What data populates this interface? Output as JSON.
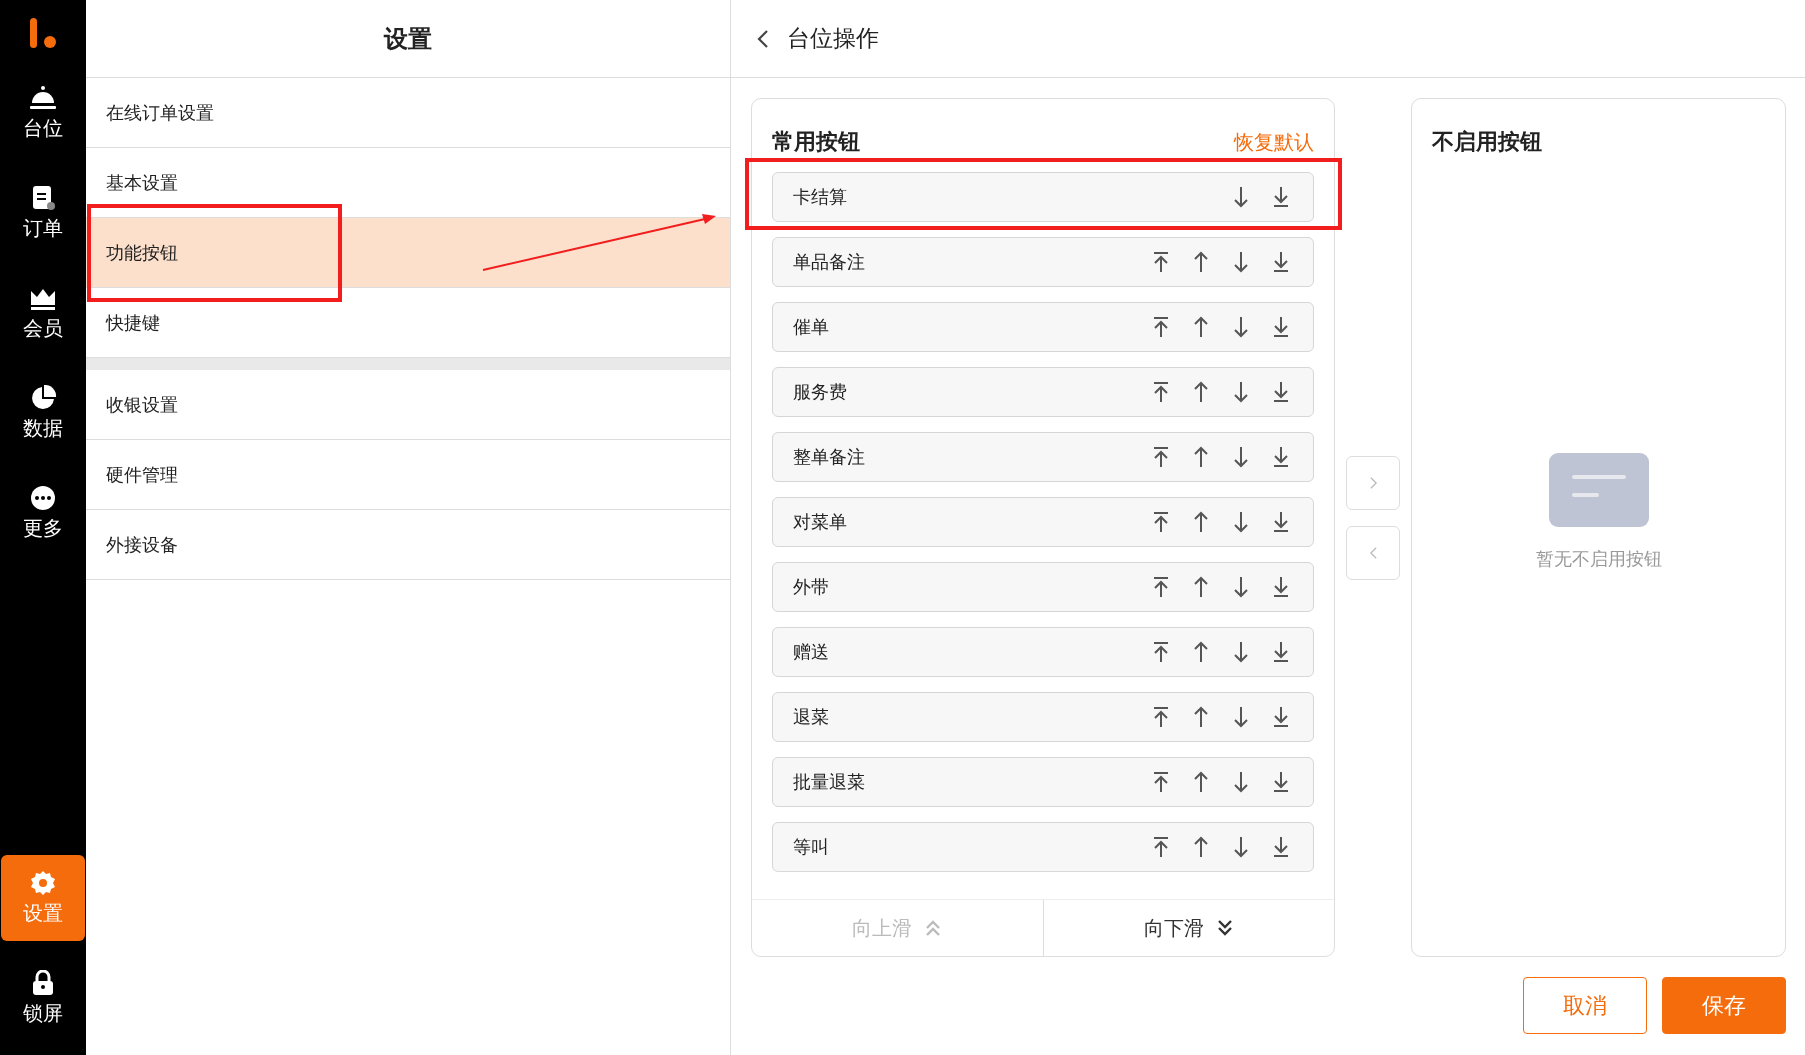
{
  "sidebar": {
    "items": [
      {
        "kind": "table",
        "label": "台位",
        "selected": false
      },
      {
        "kind": "order",
        "label": "订单",
        "selected": false
      },
      {
        "kind": "member",
        "label": "会员",
        "selected": false
      },
      {
        "kind": "data",
        "label": "数据",
        "selected": false
      },
      {
        "kind": "more",
        "label": "更多",
        "selected": false
      }
    ],
    "bottom_items": [
      {
        "kind": "settings",
        "label": "设置",
        "selected": true
      },
      {
        "kind": "lock",
        "label": "锁屏",
        "selected": false
      }
    ]
  },
  "settings": {
    "title": "设置",
    "groups": [
      [
        {
          "label": "在线订单设置",
          "selected": false
        },
        {
          "label": "基本设置",
          "selected": false
        },
        {
          "label": "功能按钮",
          "selected": true
        },
        {
          "label": "快捷键",
          "selected": false
        }
      ],
      [
        {
          "label": "收银设置",
          "selected": false
        },
        {
          "label": "硬件管理",
          "selected": false
        },
        {
          "label": "外接设备",
          "selected": false
        }
      ]
    ]
  },
  "page": {
    "title": "台位操作"
  },
  "common_buttons": {
    "title": "常用按钮",
    "reset": "恢复默认",
    "rows": [
      {
        "label": "卡结算",
        "movable_up": false
      },
      {
        "label": "单品备注",
        "movable_up": true
      },
      {
        "label": "催单",
        "movable_up": true
      },
      {
        "label": "服务费",
        "movable_up": true
      },
      {
        "label": "整单备注",
        "movable_up": true
      },
      {
        "label": "对菜单",
        "movable_up": true
      },
      {
        "label": "外带",
        "movable_up": true
      },
      {
        "label": "赠送",
        "movable_up": true
      },
      {
        "label": "退菜",
        "movable_up": true
      },
      {
        "label": "批量退菜",
        "movable_up": true
      },
      {
        "label": "等叫",
        "movable_up": true
      }
    ],
    "scroll_up": {
      "label": "向上滑",
      "disabled": true
    },
    "scroll_down": {
      "label": "向下滑",
      "disabled": false
    }
  },
  "disabled_buttons": {
    "title": "不启用按钮",
    "empty_text": "暂无不启用按钮"
  },
  "actions": {
    "cancel": "取消",
    "save": "保存"
  }
}
